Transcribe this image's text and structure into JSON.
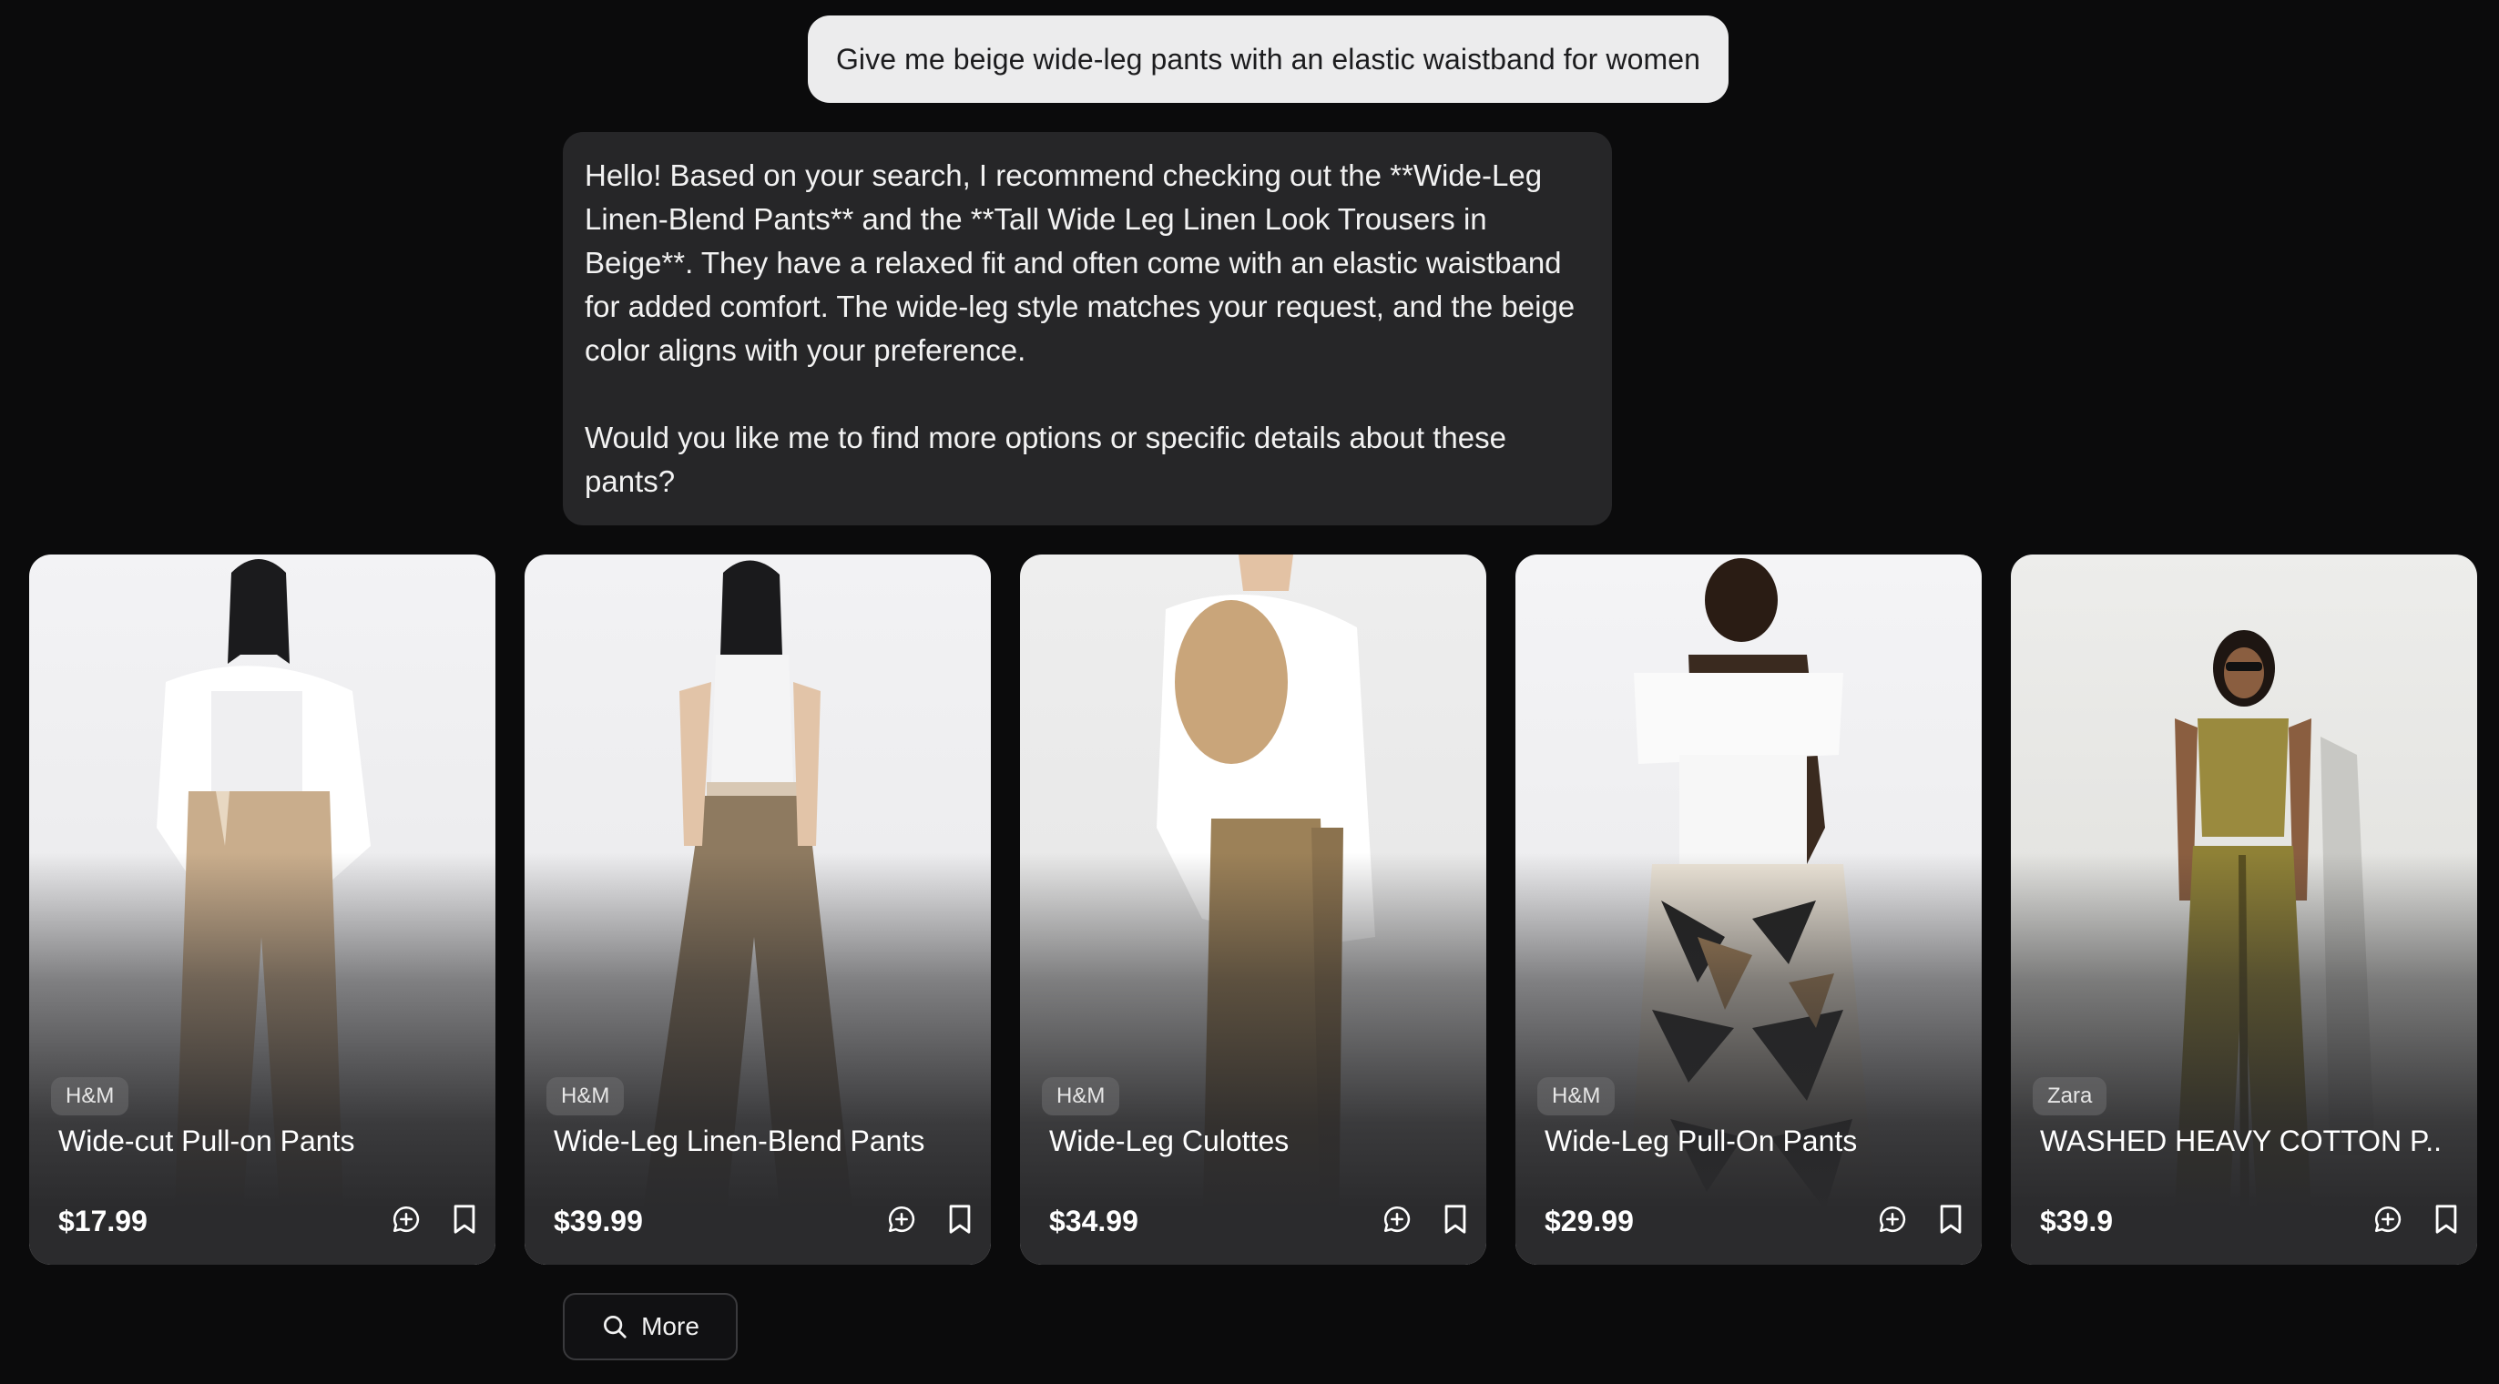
{
  "conversation": {
    "user_message": "Give me beige wide-leg pants with an elastic waistband for women",
    "assistant_paragraph_1": "Hello! Based on your search, I recommend checking out the **Wide-Leg Linen-Blend Pants** and the **Tall Wide Leg Linen Look Trousers in Beige**. They have a relaxed fit and often come with an elastic waistband for added comfort. The wide-leg style matches your request, and the beige color aligns with your preference.",
    "assistant_paragraph_2": "Would you like me to find more options or specific details about these pants?"
  },
  "products": [
    {
      "brand": "H&M",
      "title": "Wide-cut Pull-on Pants",
      "price": "$17.99"
    },
    {
      "brand": "H&M",
      "title": "Wide-Leg Linen-Blend Pants",
      "price": "$39.99"
    },
    {
      "brand": "H&M",
      "title": "Wide-Leg Culottes",
      "price": "$34.99"
    },
    {
      "brand": "H&M",
      "title": "Wide-Leg Pull-On Pants",
      "price": "$29.99"
    },
    {
      "brand": "Zara",
      "title": "WASHED HEAVY COTTON P...",
      "price": "$39.9"
    }
  ],
  "actions": {
    "more_label": "More"
  },
  "icons": {
    "chat": "chat-plus-icon",
    "save": "bookmark-icon",
    "search": "search-icon"
  },
  "colors": {
    "background": "#0b0b0c",
    "user_bubble": "#ececed",
    "assistant_bubble": "#262628",
    "card": "#2b2b2d"
  }
}
